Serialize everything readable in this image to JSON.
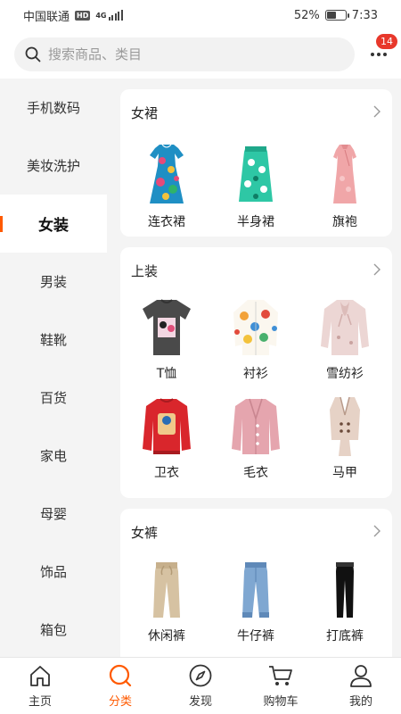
{
  "status_bar": {
    "carrier": "中国联通",
    "hd": "HD",
    "network": "4G",
    "battery": "52%",
    "battery_level": 0.52,
    "time": "7:33"
  },
  "header": {
    "search_placeholder": "搜索商品、类目",
    "message_count": "14"
  },
  "sidebar": {
    "items": [
      {
        "label": "手机数码"
      },
      {
        "label": "美妆洗护"
      },
      {
        "label": "女装"
      },
      {
        "label": "男装"
      },
      {
        "label": "鞋靴"
      },
      {
        "label": "百货"
      },
      {
        "label": "家电"
      },
      {
        "label": "母婴"
      },
      {
        "label": "饰品"
      },
      {
        "label": "箱包"
      }
    ],
    "active_index": 2
  },
  "sections": [
    {
      "title": "女裙",
      "items": [
        {
          "label": "连衣裙",
          "icon": "floral-dress-icon"
        },
        {
          "label": "半身裙",
          "icon": "floral-skirt-icon"
        },
        {
          "label": "旗袍",
          "icon": "qipao-icon"
        }
      ]
    },
    {
      "title": "上装",
      "items": [
        {
          "label": "T恤",
          "icon": "tshirt-icon"
        },
        {
          "label": "衬衫",
          "icon": "shirt-icon"
        },
        {
          "label": "雪纺衫",
          "icon": "chiffon-blouse-icon"
        },
        {
          "label": "卫衣",
          "icon": "sweatshirt-icon"
        },
        {
          "label": "毛衣",
          "icon": "sweater-icon"
        },
        {
          "label": "马甲",
          "icon": "vest-icon"
        }
      ]
    },
    {
      "title": "女裤",
      "items": [
        {
          "label": "休闲裤",
          "icon": "casual-pants-icon"
        },
        {
          "label": "牛仔裤",
          "icon": "jeans-icon"
        },
        {
          "label": "打底裤",
          "icon": "leggings-icon"
        }
      ]
    }
  ],
  "bottom_nav": [
    {
      "label": "主页",
      "icon": "home-icon"
    },
    {
      "label": "分类",
      "icon": "search-icon"
    },
    {
      "label": "发现",
      "icon": "compass-icon"
    },
    {
      "label": "购物车",
      "icon": "cart-icon"
    },
    {
      "label": "我的",
      "icon": "user-icon"
    }
  ],
  "colors": {
    "accent": "#ff5a00",
    "badge": "#e8382b",
    "background": "#f4f4f4"
  }
}
